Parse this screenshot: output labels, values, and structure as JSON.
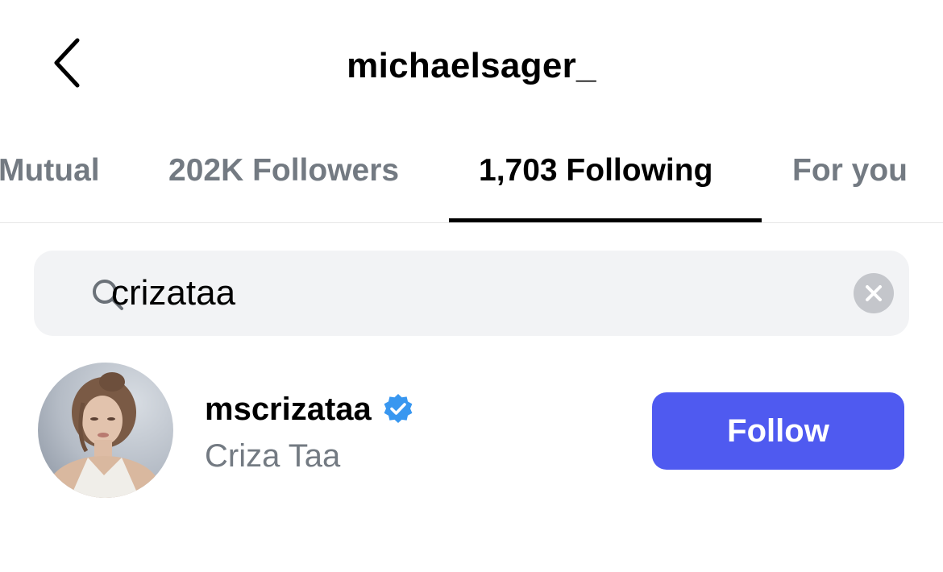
{
  "header": {
    "title": "michaelsager_",
    "back_icon": "chevron-left-icon"
  },
  "tabs": [
    {
      "label": "Mutual",
      "active": false
    },
    {
      "label": "202K Followers",
      "active": false
    },
    {
      "label": "1,703 Following",
      "active": true
    },
    {
      "label": "For you",
      "active": false
    }
  ],
  "search": {
    "value": "crizataa",
    "icon": "search-icon",
    "clear_icon": "clear-icon"
  },
  "results": [
    {
      "username": "mscrizataa",
      "full_name": "Criza Taa",
      "verified": true,
      "follow_label": "Follow"
    }
  ],
  "colors": {
    "accent": "#4f5af0",
    "verified": "#3897f0",
    "muted_text": "#737a82",
    "search_bg": "#f2f3f5"
  }
}
